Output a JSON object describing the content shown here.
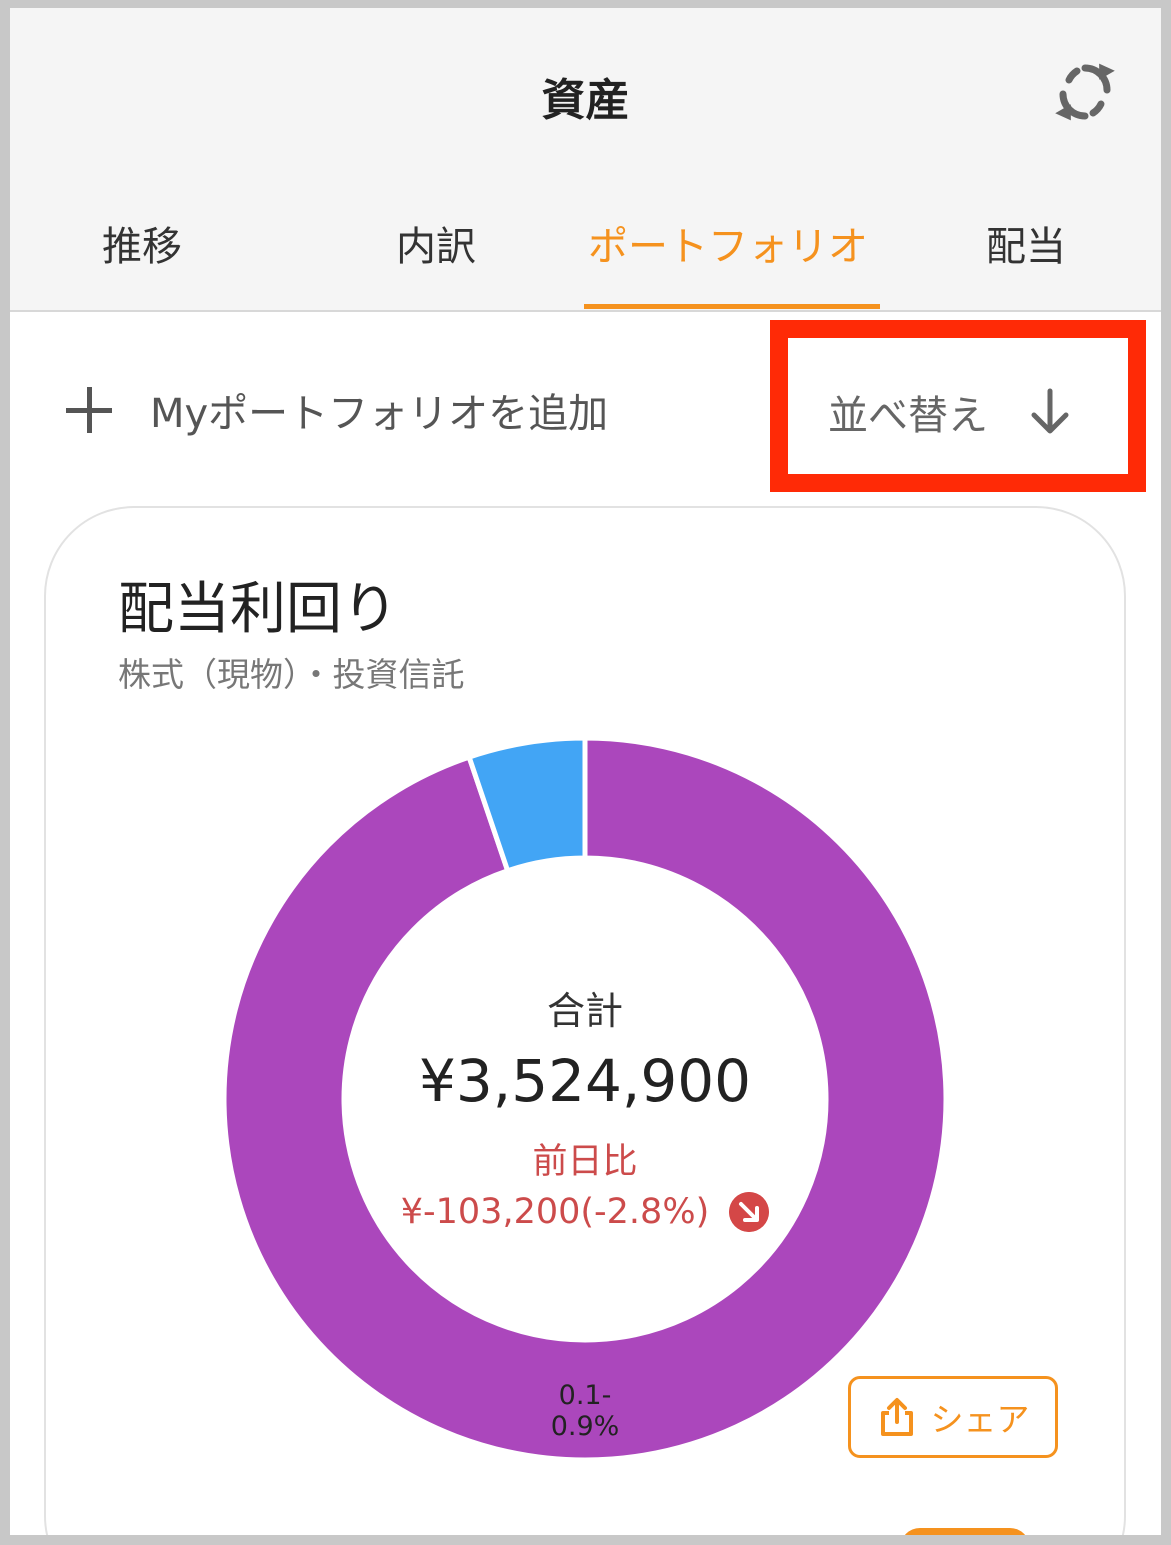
{
  "header": {
    "title": "資産",
    "refresh_icon": "refresh-icon"
  },
  "tabs": [
    {
      "label": "推移",
      "active": false
    },
    {
      "label": "内訳",
      "active": false
    },
    {
      "label": "ポートフォリオ",
      "active": true
    },
    {
      "label": "配当",
      "active": false
    }
  ],
  "actions": {
    "add_label": "Myポートフォリオを追加",
    "sort_label": "並べ替え"
  },
  "card": {
    "title": "配当利回り",
    "subtitle": "株式（現物）・投資信託",
    "total_label": "合計",
    "total_value": "¥3,524,900",
    "diff_label": "前日比",
    "diff_value": "¥-103,200(-2.8%)",
    "share_label": "シェア"
  },
  "chart_data": {
    "type": "pie",
    "total": "¥3,524,900",
    "slices": [
      {
        "label": "0.1-0.9%",
        "value": 0.948,
        "color": "#ab47bc"
      },
      {
        "label": "",
        "value": 0.052,
        "color": "#42a5f5"
      }
    ]
  },
  "colors": {
    "accent": "#f5921e",
    "negative": "#cc4b4b",
    "highlight": "#ff2a06"
  }
}
